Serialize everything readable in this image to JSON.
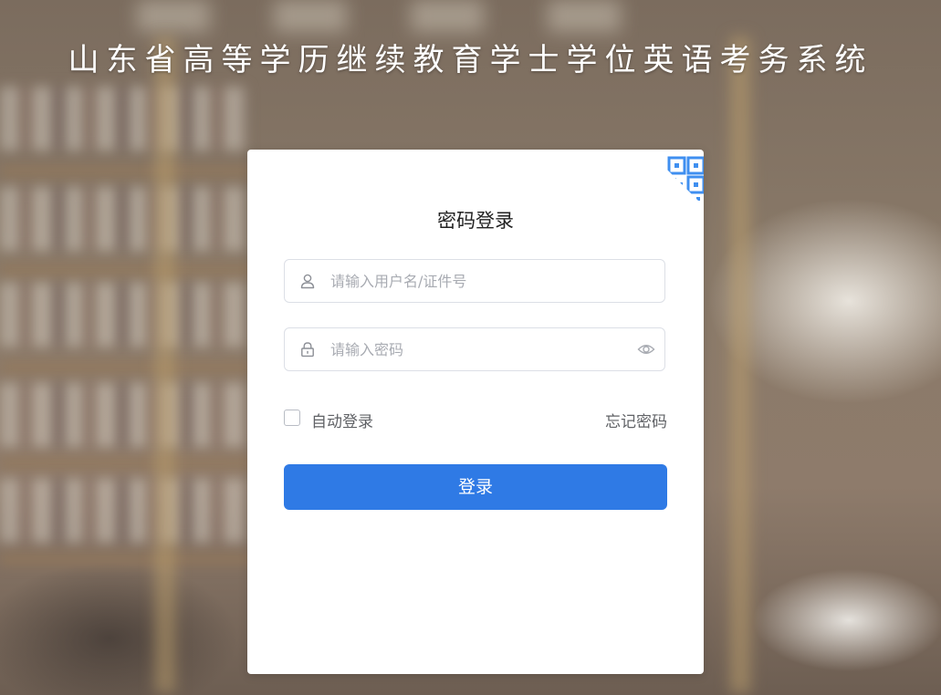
{
  "header": {
    "title": "山东省高等学历继续教育学士学位英语考务系统"
  },
  "login": {
    "heading": "密码登录",
    "username": {
      "placeholder": "请输入用户名/证件号",
      "value": ""
    },
    "password": {
      "placeholder": "请输入密码",
      "value": ""
    },
    "auto_login_label": "自动登录",
    "auto_login_checked": false,
    "forgot_password_label": "忘记密码",
    "submit_label": "登录"
  },
  "icons": {
    "qr_toggle": "qr-code-icon",
    "username": "user-icon",
    "password": "lock-icon",
    "show_password": "eye-icon"
  },
  "colors": {
    "primary": "#2f7ae5",
    "qr_blue": "#3f8ff0",
    "text": "#222222",
    "muted": "#606266",
    "placeholder": "#a8abb2",
    "border": "#dcdfe6"
  }
}
